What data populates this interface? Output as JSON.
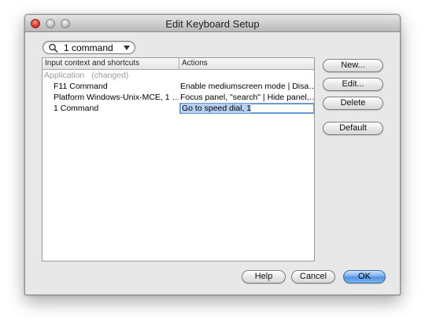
{
  "window": {
    "title": "Edit Keyboard Setup"
  },
  "search": {
    "value": "1 command",
    "icon": "magnifying-glass-icon"
  },
  "table": {
    "columns": [
      "Input context and shortcuts",
      "Actions"
    ],
    "group": {
      "label": "Application",
      "status": "(changed)"
    },
    "rows": [
      {
        "shortcut": "F11 Command",
        "action": "Enable mediumscreen mode | Disa…"
      },
      {
        "shortcut": "Platform Windows-Unix-MCE, 1 …",
        "action": "Focus panel, \"search\" | Hide panel,…"
      },
      {
        "shortcut": "1 Command",
        "action": "Go to speed dial, 1"
      }
    ]
  },
  "buttons": {
    "new": "New...",
    "edit": "Edit...",
    "delete": "Delete",
    "default": "Default",
    "help": "Help",
    "cancel": "Cancel",
    "ok": "OK"
  },
  "colors": {
    "accent": "#5b97e3",
    "selection": "#b5d0f3"
  }
}
